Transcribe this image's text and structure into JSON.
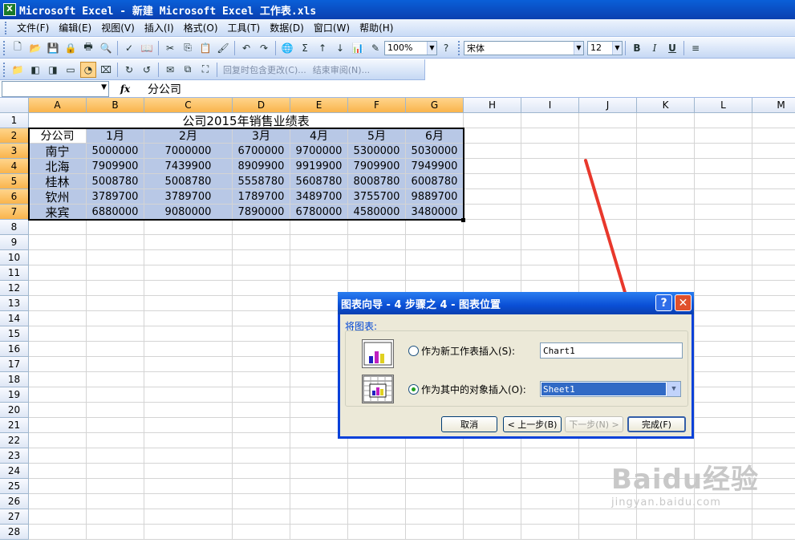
{
  "window": {
    "title": "Microsoft Excel - 新建 Microsoft Excel 工作表.xls",
    "app_icon": "excel-icon"
  },
  "menu": [
    "文件(F)",
    "编辑(E)",
    "视图(V)",
    "插入(I)",
    "格式(O)",
    "工具(T)",
    "数据(D)",
    "窗口(W)",
    "帮助(H)"
  ],
  "toolbar": {
    "zoom": "100%",
    "font_name": "宋体",
    "font_size": "12",
    "bold": "B",
    "italic": "I",
    "underline": "U",
    "sum": "Σ"
  },
  "review_toolbar": {
    "reply_changes": "回复时包含更改(C)...",
    "end_review": "结束审阅(N)..."
  },
  "formula_bar": {
    "name_box": "",
    "fx": "fx",
    "value": "分公司"
  },
  "sheet": {
    "columns": [
      "A",
      "B",
      "C",
      "D",
      "E",
      "F",
      "G",
      "H",
      "I",
      "J",
      "K",
      "L",
      "M"
    ],
    "rows": [
      "1",
      "2",
      "3",
      "4",
      "5",
      "6",
      "7",
      "8",
      "9",
      "10",
      "11",
      "12",
      "13",
      "14",
      "15",
      "16",
      "17",
      "18",
      "19",
      "20",
      "21",
      "22",
      "23",
      "24",
      "25",
      "26",
      "27",
      "28"
    ],
    "title": "公司2015年销售业绩表",
    "headers": [
      "分公司",
      "1月",
      "2月",
      "3月",
      "4月",
      "5月",
      "6月"
    ],
    "data": [
      [
        "南宁",
        "5000000",
        "7000000",
        "6700000",
        "9700000",
        "5300000",
        "5030000"
      ],
      [
        "北海",
        "7909900",
        "7439900",
        "8909900",
        "9919900",
        "7909900",
        "7949900"
      ],
      [
        "桂林",
        "5008780",
        "5008780",
        "5558780",
        "5608780",
        "8008780",
        "6008780"
      ],
      [
        "钦州",
        "3789700",
        "3789700",
        "1789700",
        "3489700",
        "3755700",
        "9889700"
      ],
      [
        "来宾",
        "6880000",
        "9080000",
        "7890000",
        "6780000",
        "4580000",
        "3480000"
      ]
    ]
  },
  "dialog": {
    "title": "图表向导 - 4 步骤之 4 - 图表位置",
    "help": "?",
    "close": "✕",
    "group_label": "将图表:",
    "option_new_sheet": "作为新工作表插入(S):",
    "new_sheet_name": "Chart1",
    "option_object": "作为其中的对象插入(O):",
    "object_sheet": "Sheet1",
    "cancel": "取消",
    "back": "< 上一步(B)",
    "next": "下一步(N) >",
    "finish": "完成(F)"
  },
  "watermark": {
    "logo": "Baidu经验",
    "url": "jingyan.baidu.com"
  },
  "colors": {
    "titlebar": "#0a4fd6",
    "selection": "#b8c8e6",
    "arrow": "#e8382c"
  }
}
